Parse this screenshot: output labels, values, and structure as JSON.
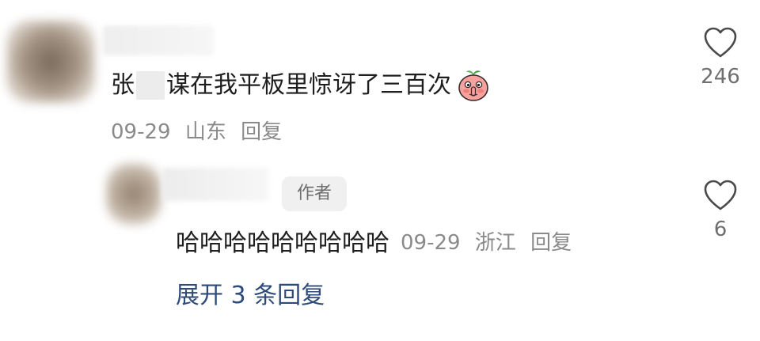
{
  "comment": {
    "text_prefix": "张",
    "text_suffix": "谋在我平板里惊讶了三百次",
    "emoji": "shh-peach-emoji",
    "date": "09-29",
    "location": "山东",
    "reply_label": "回复",
    "like_count": "246"
  },
  "reply": {
    "author_badge": "作者",
    "text": "哈哈哈哈哈哈哈哈哈",
    "date": "09-29",
    "location": "浙江",
    "reply_label": "回复",
    "like_count": "6"
  },
  "expand": {
    "label": "展开 3 条回复"
  },
  "colors": {
    "text": "#1e1e1e",
    "meta": "#8a8a8a",
    "link": "#2d4a79",
    "badge_bg": "#f0f0f0"
  }
}
